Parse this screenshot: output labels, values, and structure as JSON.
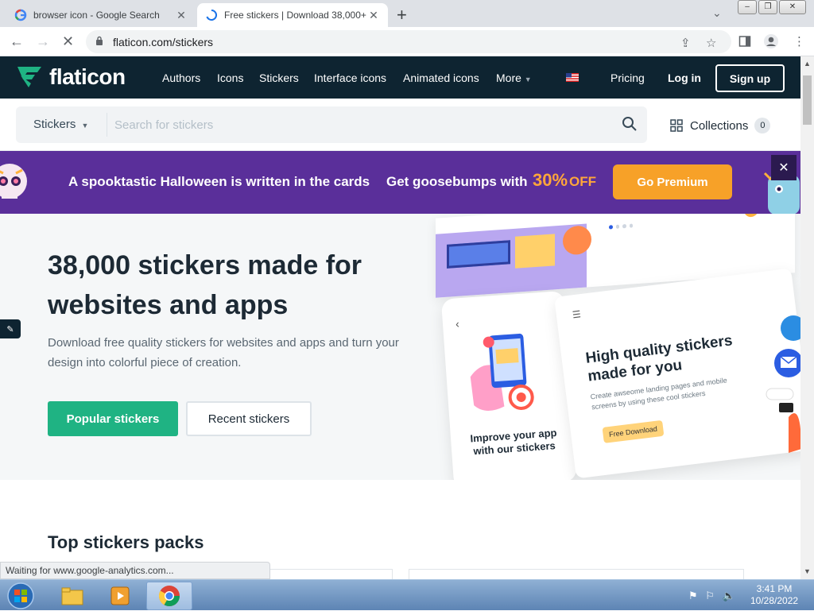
{
  "browser": {
    "tabs": [
      {
        "title": "browser icon - Google Search",
        "active": false
      },
      {
        "title": "Free stickers | Download 38,000+",
        "active": true
      }
    ],
    "url": "flaticon.com/stickers",
    "status_text": "Waiting for www.google-analytics.com..."
  },
  "site": {
    "logo_text": "flaticon",
    "nav": [
      "Authors",
      "Icons",
      "Stickers",
      "Interface icons",
      "Animated icons",
      "More"
    ],
    "pricing": "Pricing",
    "login": "Log in",
    "signup": "Sign up"
  },
  "search": {
    "category": "Stickers",
    "placeholder": "Search for stickers",
    "collections_label": "Collections",
    "collections_count": "0"
  },
  "banner": {
    "text1": "A spooktastic Halloween is written in the cards",
    "text2": "Get goosebumps with",
    "percent": "30%",
    "off": "OFF",
    "cta": "Go Premium"
  },
  "hero": {
    "title": "38,000 stickers made for websites and apps",
    "subtitle": "Download free quality stickers for websites and apps and turn your design into colorful piece of creation.",
    "btn_popular": "Popular stickers",
    "btn_recent": "Recent stickers",
    "mock_card_title": "High quality stickers made for you",
    "mock_card_sub": "Create awseome landing pages and mobile screens by using these cool stickers",
    "mock_card_btn": "Free Download",
    "mock_phone_text": "Improve your app with our stickers"
  },
  "section": {
    "top_packs": "Top stickers packs"
  },
  "taskbar": {
    "time": "3:41 PM",
    "date": "10/28/2022"
  },
  "colors": {
    "header_bg": "#0e2431",
    "banner_bg": "#5a2f9a",
    "premium_orange": "#f7a128",
    "green": "#1fb383"
  }
}
